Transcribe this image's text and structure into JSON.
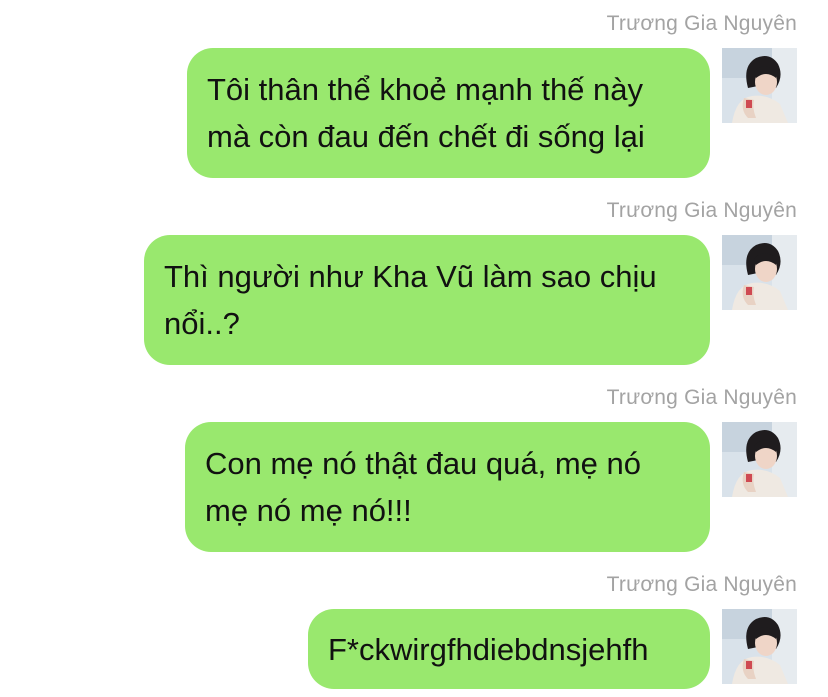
{
  "messages": [
    {
      "sender": "Trương Gia Nguyên",
      "text": "Tôi thân thể khoẻ mạnh thế này mà còn đau đến chết đi sống lại",
      "avatar": "profile-photo"
    },
    {
      "sender": "Trương Gia Nguyên",
      "text": "Thì người như Kha Vũ làm sao chịu nổi..?",
      "avatar": "profile-photo"
    },
    {
      "sender": "Trương Gia Nguyên",
      "text": "Con mẹ nó thật đau quá, mẹ nó mẹ nó mẹ nó!!!",
      "avatar": "profile-photo"
    },
    {
      "sender": "Trương Gia Nguyên",
      "text": "F*ckwirgfhdiebdnsjehfh",
      "avatar": "profile-photo"
    }
  ],
  "colors": {
    "bubble": "#99e86e",
    "sender_name": "#a3a3a3",
    "message_text": "#111111",
    "background": "#ffffff"
  }
}
